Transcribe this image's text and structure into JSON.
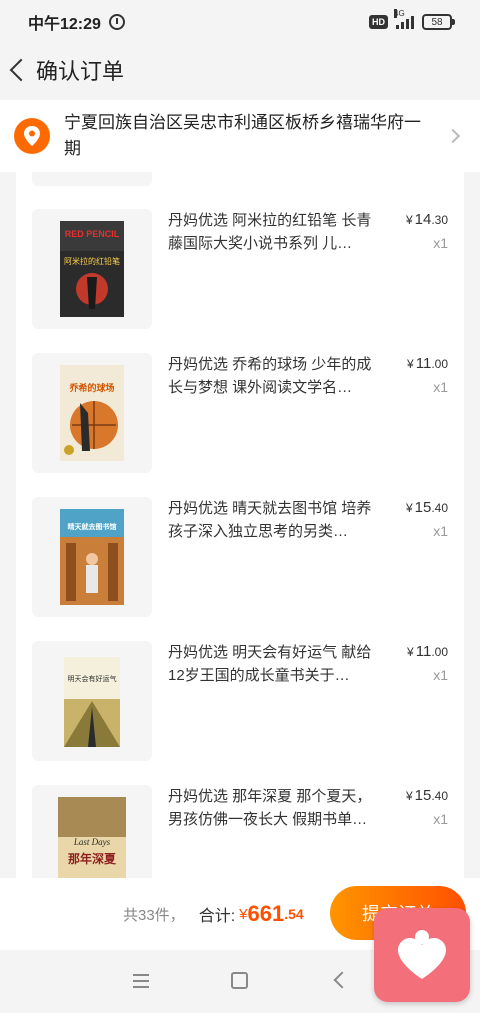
{
  "status": {
    "time": "中午12:29",
    "hd": "HD",
    "network": "4G",
    "battery": "58"
  },
  "header": {
    "title": "确认订单"
  },
  "address": {
    "text": "宁夏回族自治区吴忠市利通区板桥乡禧瑞华府一期"
  },
  "items": [
    {
      "title": "丹妈优选 阿米拉的红铅笔 长青藤国际大奖小说书系列 儿…",
      "price_int": "14",
      "price_cents": ".30",
      "qty": "x1",
      "cover": "red-pencil"
    },
    {
      "title": "丹妈优选 乔希的球场 少年的成长与梦想 课外阅读文学名…",
      "price_int": "11",
      "price_cents": ".00",
      "qty": "x1",
      "cover": "basketball"
    },
    {
      "title": "丹妈优选 晴天就去图书馆 培养孩子深入独立思考的另类…",
      "price_int": "15",
      "price_cents": ".40",
      "qty": "x1",
      "cover": "library"
    },
    {
      "title": "丹妈优选 明天会有好运气 献给12岁王国的成长童书关于…",
      "price_int": "11",
      "price_cents": ".00",
      "qty": "x1",
      "cover": "good-luck"
    },
    {
      "title": "丹妈优选 那年深夏 那个夏天，男孩仿佛一夜长大 假期书单…",
      "price_int": "15",
      "price_cents": ".40",
      "qty": "x1",
      "cover": "late-summer"
    }
  ],
  "cover_text": {
    "red_pencil_en": "RED PENCIL",
    "red_pencil_cn": "阿米拉的红铅笔",
    "basketball_cn": "乔希的球场",
    "library_cn": "晴天就去图书馆",
    "good_luck_cn": "明天会有好运气",
    "late_summer_en": "Last Days",
    "late_summer_cn": "那年深夏"
  },
  "currency": "¥",
  "footer": {
    "count": "共33件，",
    "total_label": "合计:",
    "total_yen": "¥",
    "total_int": "661",
    "total_cents": ".54",
    "submit_label": "提交订单"
  },
  "colors": {
    "accent": "#ff5000",
    "accent_light": "#ff9500",
    "location_icon": "#ff6a00",
    "heart_bg": "#f36f7a"
  }
}
